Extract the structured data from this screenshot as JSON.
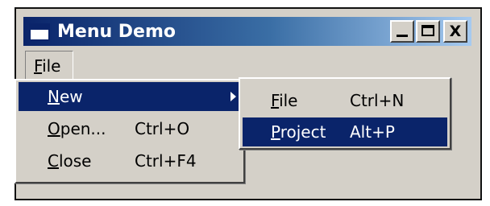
{
  "window": {
    "title": "Menu Demo",
    "close_symbol": "X"
  },
  "menubar": {
    "file": "File"
  },
  "menu": {
    "items": [
      {
        "label": "New",
        "shortcut": "",
        "has_submenu": true,
        "selected": true
      },
      {
        "label": "Open...",
        "shortcut": "Ctrl+O"
      },
      {
        "label": "Close",
        "shortcut": "Ctrl+F4"
      }
    ]
  },
  "submenu": {
    "items": [
      {
        "label": "File",
        "shortcut": "Ctrl+N"
      },
      {
        "label": "Project",
        "shortcut": "Alt+P",
        "selected": true
      }
    ]
  },
  "colors": {
    "selection": "#0a246a",
    "face": "#d4d0c8"
  },
  "icons": [
    "app-window-icon",
    "minimize-icon",
    "maximize-icon",
    "close-icon",
    "submenu-arrow-icon"
  ]
}
